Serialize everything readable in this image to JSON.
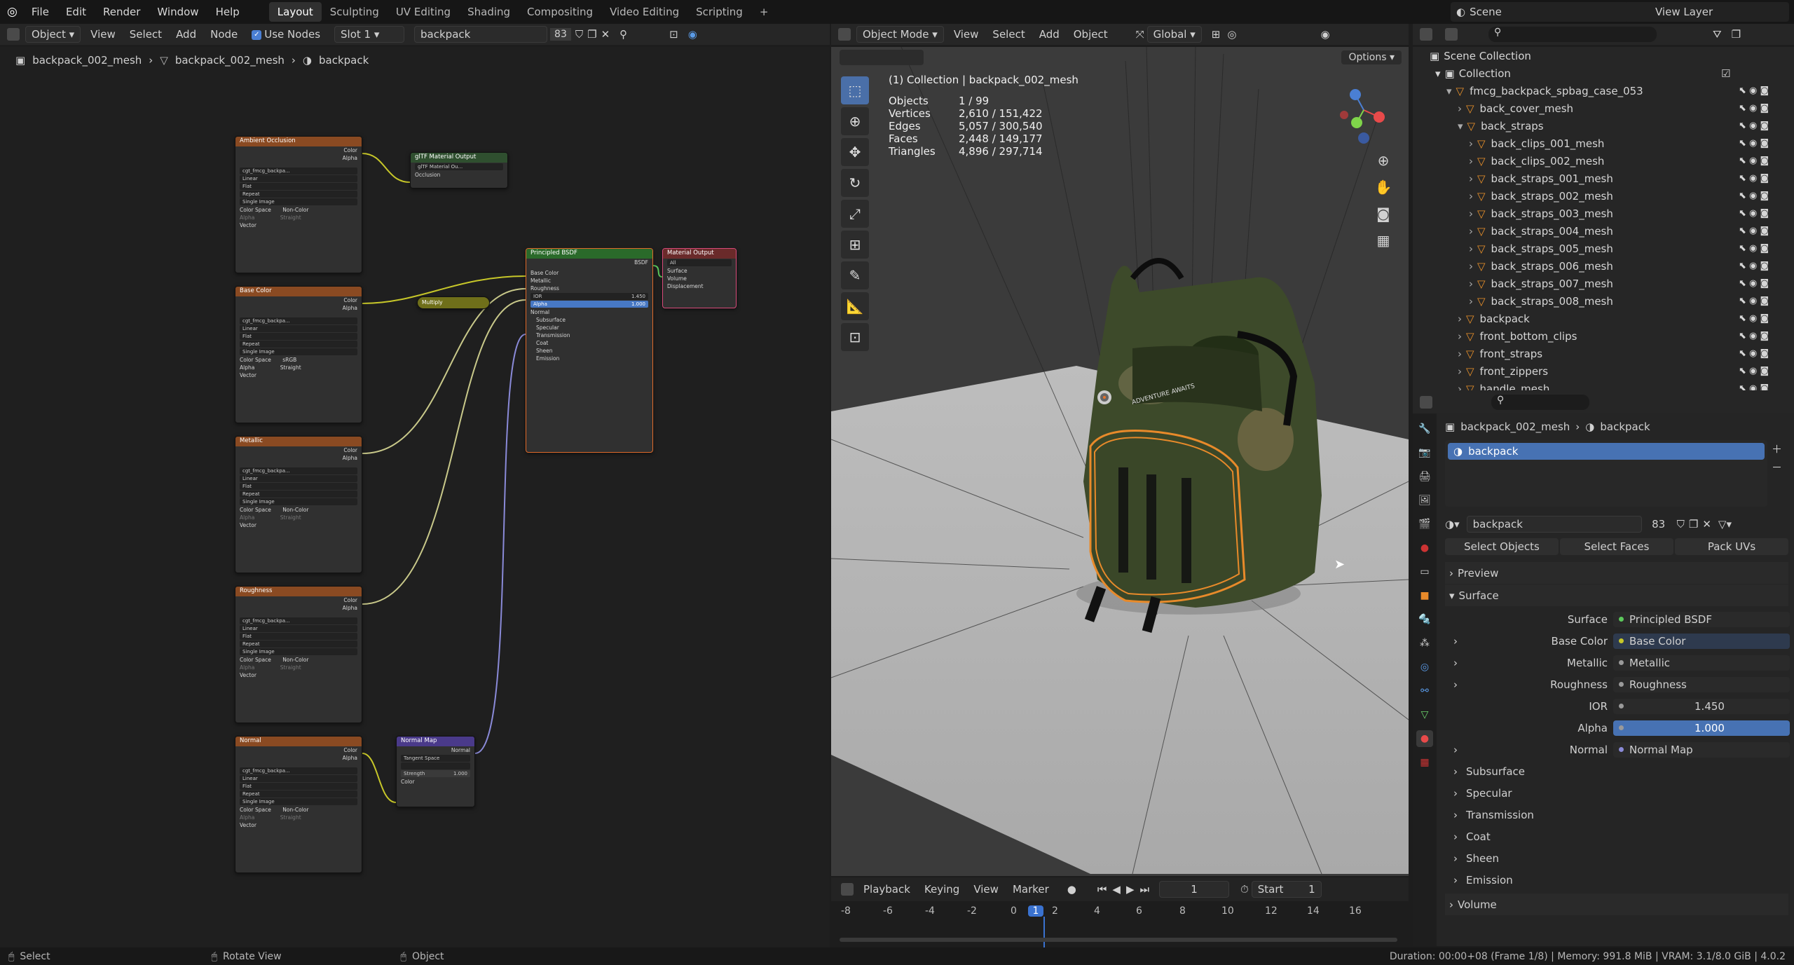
{
  "menu": [
    "File",
    "Edit",
    "Render",
    "Window",
    "Help"
  ],
  "workspaces": [
    "Layout",
    "Sculpting",
    "UV Editing",
    "Shading",
    "Compositing",
    "Video Editing",
    "Scripting"
  ],
  "workspace_add": "+",
  "scene": "Scene",
  "view_layer": "View Layer",
  "node_header": {
    "mode": "Object",
    "view": "View",
    "select": "Select",
    "add": "Add",
    "node": "Node",
    "use_nodes": "Use Nodes",
    "slot": "Slot 1",
    "material": "backpack",
    "users": "83"
  },
  "breadcrumb": [
    "backpack_002_mesh",
    "backpack_002_mesh",
    "backpack"
  ],
  "nodes": {
    "ao": {
      "title": "Ambient Occlusion",
      "out1": "Color",
      "out2": "Alpha",
      "img": "cgt_fmcg_backpa...",
      "f": [
        "Linear",
        "Flat",
        "Repeat",
        "Single Image"
      ],
      "cs_label": "Color Space",
      "cs": "Non-Color",
      "alpha_label": "Alpha",
      "alpha": "Straight",
      "vec": "Vector"
    },
    "base": {
      "title": "Base Color",
      "out1": "Color",
      "out2": "Alpha",
      "img": "cgt_fmcg_backpa...",
      "f": [
        "Linear",
        "Flat",
        "Repeat",
        "Single Image"
      ],
      "cs_label": "Color Space",
      "cs": "sRGB",
      "alpha_label": "Alpha",
      "alpha": "Straight",
      "vec": "Vector"
    },
    "metal": {
      "title": "Metallic",
      "out1": "Color",
      "out2": "Alpha",
      "img": "cgt_fmcg_backpa...",
      "f": [
        "Linear",
        "Flat",
        "Repeat",
        "Single Image"
      ],
      "cs_label": "Color Space",
      "cs": "Non-Color",
      "alpha_label": "Alpha",
      "alpha": "Straight",
      "vec": "Vector"
    },
    "rough": {
      "title": "Roughness",
      "out1": "Color",
      "out2": "Alpha",
      "img": "cgt_fmcg_backpa...",
      "f": [
        "Linear",
        "Flat",
        "Repeat",
        "Single Image"
      ],
      "cs_label": "Color Space",
      "cs": "Non-Color",
      "alpha_label": "Alpha",
      "alpha": "Straight",
      "vec": "Vector"
    },
    "normal": {
      "title": "Normal",
      "out1": "Color",
      "out2": "Alpha",
      "img": "cgt_fmcg_backpa...",
      "f": [
        "Linear",
        "Flat",
        "Repeat",
        "Single Image"
      ],
      "cs_label": "Color Space",
      "cs": "Non-Color",
      "alpha_label": "Alpha",
      "alpha": "Straight",
      "vec": "Vector"
    },
    "gltf": {
      "title": "glTF Material Output",
      "sub": "glTF Material Ou...",
      "in": "Occlusion"
    },
    "multiply": {
      "title": "Multiply"
    },
    "bsdf": {
      "title": "Principled BSDF",
      "out": "BSDF",
      "inputs": [
        "Base Color",
        "Metallic",
        "Roughness"
      ],
      "ior_label": "IOR",
      "ior": "1.450",
      "alpha_label": "Alpha",
      "alpha": "1.000",
      "rest": [
        "Normal",
        "Subsurface",
        "Specular",
        "Transmission",
        "Coat",
        "Sheen",
        "Emission"
      ]
    },
    "matout": {
      "title": "Material Output",
      "target": "All",
      "inputs": [
        "Surface",
        "Volume",
        "Displacement"
      ]
    },
    "nmap": {
      "title": "Normal Map",
      "out": "Normal",
      "space": "Tangent Space",
      "strength_label": "Strength",
      "strength": "1.000",
      "in": "Color"
    }
  },
  "viewport_header": {
    "mode": "Object Mode",
    "view": "View",
    "select": "Select",
    "add": "Add",
    "object": "Object",
    "orientation": "Global",
    "options": "Options"
  },
  "stats": {
    "title": "(1) Collection | backpack_002_mesh",
    "rows": [
      [
        "Objects",
        "1 / 99"
      ],
      [
        "Vertices",
        "2,610 / 151,422"
      ],
      [
        "Edges",
        "5,057 / 300,540"
      ],
      [
        "Faces",
        "2,448 / 149,177"
      ],
      [
        "Triangles",
        "4,896 / 297,714"
      ]
    ]
  },
  "viewport_logo": "ADVENTURE AWAITS",
  "timeline": {
    "playback": "Playback",
    "keying": "Keying",
    "view": "View",
    "marker": "Marker",
    "frame": "1",
    "start_label": "Start",
    "start": "1",
    "ticks": [
      "-8",
      "-6",
      "-4",
      "-2",
      "0",
      "1",
      "2",
      "4",
      "6",
      "8",
      "10",
      "12",
      "14",
      "16"
    ]
  },
  "outliner": {
    "root": "Scene Collection",
    "collection": "Collection",
    "items": [
      {
        "name": "fmcg_backpack_spbag_case_053",
        "indent": 1
      },
      {
        "name": "back_cover_mesh",
        "indent": 2
      },
      {
        "name": "back_straps",
        "indent": 2
      },
      {
        "name": "back_clips_001_mesh",
        "indent": 3
      },
      {
        "name": "back_clips_002_mesh",
        "indent": 3
      },
      {
        "name": "back_straps_001_mesh",
        "indent": 3
      },
      {
        "name": "back_straps_002_mesh",
        "indent": 3
      },
      {
        "name": "back_straps_003_mesh",
        "indent": 3
      },
      {
        "name": "back_straps_004_mesh",
        "indent": 3
      },
      {
        "name": "back_straps_005_mesh",
        "indent": 3
      },
      {
        "name": "back_straps_006_mesh",
        "indent": 3
      },
      {
        "name": "back_straps_007_mesh",
        "indent": 3
      },
      {
        "name": "back_straps_008_mesh",
        "indent": 3
      },
      {
        "name": "backpack",
        "indent": 2
      },
      {
        "name": "front_bottom_clips",
        "indent": 2
      },
      {
        "name": "front_straps",
        "indent": 2
      },
      {
        "name": "front_zippers",
        "indent": 2
      },
      {
        "name": "handle_mesh",
        "indent": 2
      }
    ]
  },
  "props": {
    "breadcrumb": [
      "backpack_002_mesh",
      "backpack"
    ],
    "slot": "backpack",
    "material": "backpack",
    "users": "83",
    "buttons": [
      "Select Objects",
      "Select Faces",
      "Pack UVs"
    ],
    "preview": "Preview",
    "surface_section": "Surface",
    "rows": [
      [
        "Surface",
        "Principled BSDF"
      ],
      [
        "Base Color",
        "Base Color"
      ],
      [
        "Metallic",
        "Metallic"
      ],
      [
        "Roughness",
        "Roughness"
      ],
      [
        "IOR",
        "1.450"
      ],
      [
        "Alpha",
        "1.000"
      ],
      [
        "Normal",
        "Normal Map"
      ]
    ],
    "subs": [
      "Subsurface",
      "Specular",
      "Transmission",
      "Coat",
      "Sheen",
      "Emission"
    ],
    "volume": "Volume"
  },
  "status": {
    "select": "Select",
    "rotate": "Rotate View",
    "object": "Object",
    "info": "Duration: 00:00+08 (Frame 1/8) | Memory: 991.8 MiB | VRAM: 3.1/8.0 GiB | 4.0.2"
  }
}
